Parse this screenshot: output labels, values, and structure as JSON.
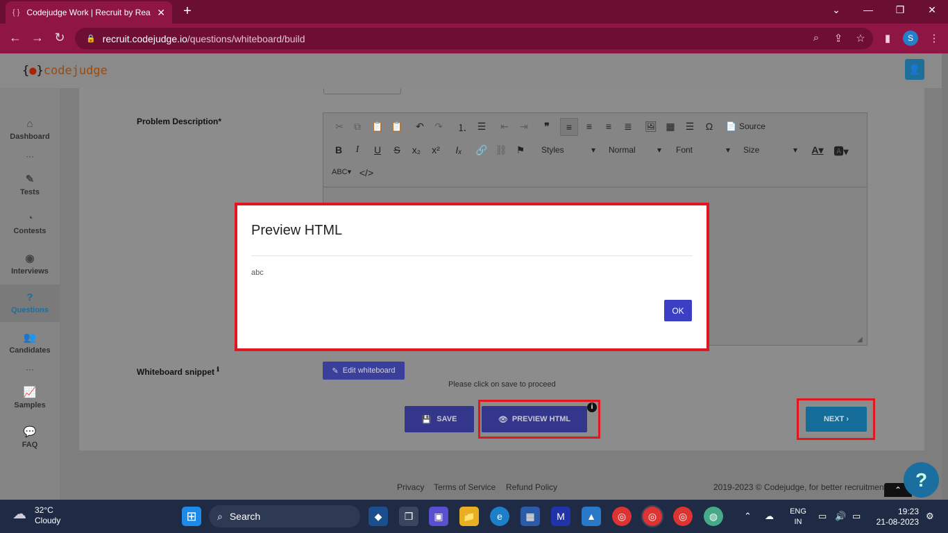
{
  "browser": {
    "tab_title": "Codejudge Work | Recruit by Rea",
    "tab_close": "✕",
    "new_tab": "+",
    "url_domain": "recruit.codejudge.io",
    "url_path": "/questions/whiteboard/build",
    "profile_initial": "S"
  },
  "header": {
    "logo_brace_open": "{",
    "logo_brace_close": "}",
    "logo_word": "codejudge"
  },
  "sidebar": {
    "items": [
      {
        "label": "Dashboard",
        "icon": "home-icon"
      },
      {
        "label": "Tests",
        "icon": "pencil-icon"
      },
      {
        "label": "Contests",
        "icon": "pie-chart-icon"
      },
      {
        "label": "Interviews",
        "icon": "podcast-icon"
      },
      {
        "label": "Questions",
        "icon": "question-circle-icon"
      },
      {
        "label": "Candidates",
        "icon": "users-icon"
      },
      {
        "label": "Samples",
        "icon": "line-chart-icon"
      },
      {
        "label": "FAQ",
        "icon": "comments-icon"
      }
    ],
    "dots": "···",
    "active_color": "#1a6ea0"
  },
  "form": {
    "problem_label": "Problem Description*",
    "whiteboard_label": "Whiteboard snippet",
    "edit_whiteboard": "Edit whiteboard",
    "hint": "Please click on save to proceed",
    "save": "SAVE",
    "preview_html": "PREVIEW HTML",
    "next": "NEXT ›"
  },
  "editor": {
    "source": "Source",
    "styles": "Styles",
    "format": "Normal",
    "font": "Font",
    "size": "Size"
  },
  "modal": {
    "title": "Preview HTML",
    "body": "abc",
    "ok": "OK"
  },
  "footer": {
    "privacy": "Privacy",
    "terms": "Terms of Service",
    "refund": "Refund Policy",
    "copyright": "2019-2023 ©  Codejudge, for better recruitment"
  },
  "taskbar": {
    "temp": "32°C",
    "condition": "Cloudy",
    "search": "Search",
    "lang_line1": "ENG",
    "lang_line2": "IN",
    "time": "19:23",
    "date": "21-08-2023"
  },
  "colors": {
    "highlight": "#e0171f",
    "primary": "#3a3fc4",
    "chrome": "#8e1544"
  }
}
